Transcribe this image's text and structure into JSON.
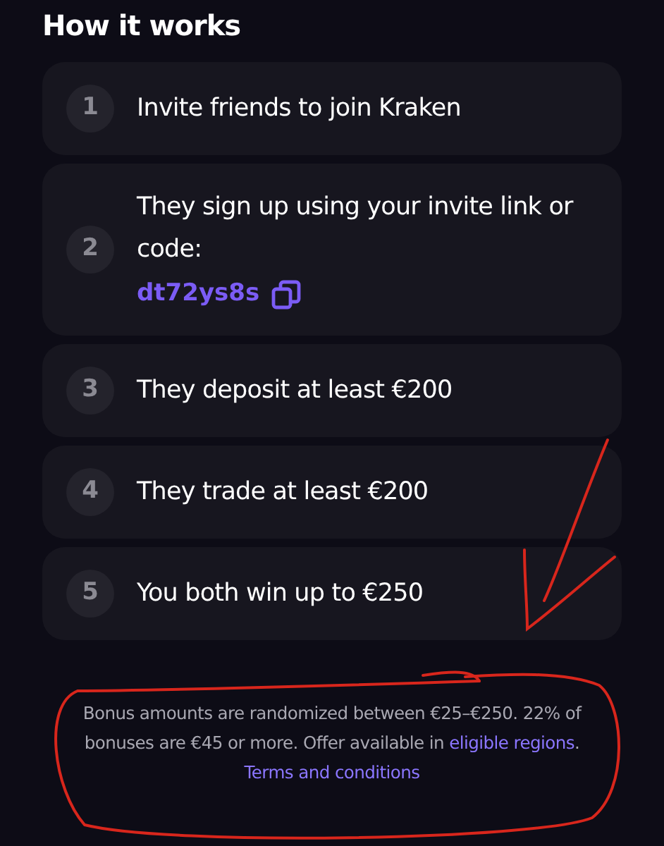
{
  "title": "How it works",
  "steps": [
    {
      "number": "1",
      "text": "Invite friends to join Kraken"
    },
    {
      "number": "2",
      "text": "They sign up using your invite link or code:",
      "code": "dt72ys8s"
    },
    {
      "number": "3",
      "text": "They deposit at least €200"
    },
    {
      "number": "4",
      "text": "They trade at least €200"
    },
    {
      "number": "5",
      "text": "You both win up to €250"
    }
  ],
  "footnote": {
    "text": "Bonus amounts are randomized between €25–€250. 22% of bonuses are €45 or more. Offer available in ",
    "link": "eligible regions",
    "after": ".",
    "terms": "Terms and conditions"
  }
}
